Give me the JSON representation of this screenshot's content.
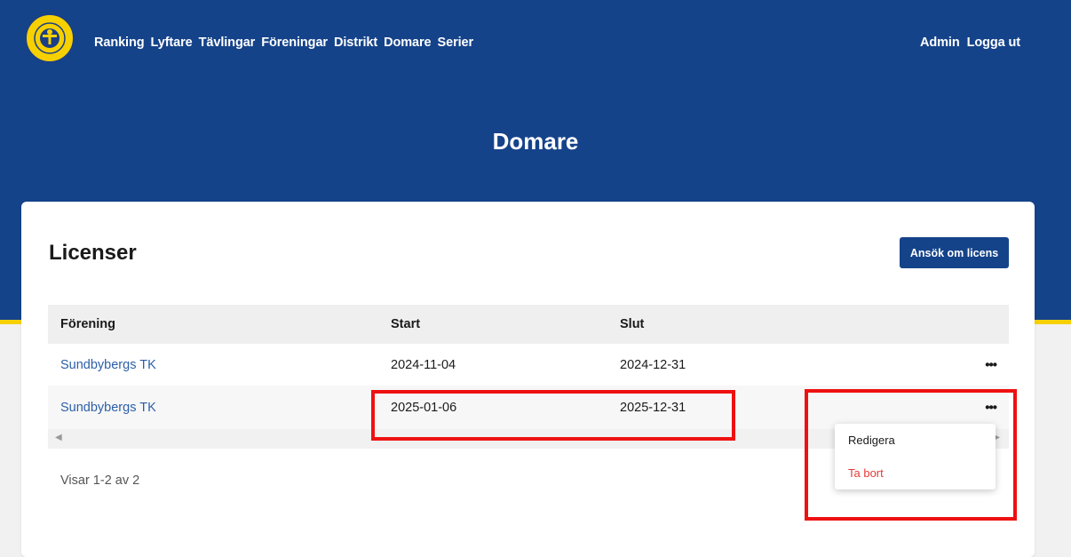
{
  "nav": {
    "items": [
      "Ranking",
      "Lyftare",
      "Tävlingar",
      "Föreningar",
      "Distrikt",
      "Domare",
      "Serier"
    ],
    "admin": "Admin",
    "logout": "Logga ut"
  },
  "page": {
    "title": "Domare"
  },
  "licenses": {
    "title": "Licenser",
    "apply_button": "Ansök om licens",
    "columns": [
      "Förening",
      "Start",
      "Slut"
    ],
    "rows": [
      {
        "club": "Sundbybergs TK",
        "start": "2024-11-04",
        "end": "2024-12-31",
        "actions": "•••"
      },
      {
        "club": "Sundbybergs TK",
        "start": "2025-01-06",
        "end": "2025-12-31",
        "actions": "•••"
      }
    ],
    "summary": "Visar 1-2 av 2",
    "scroll_left": "◀",
    "scroll_right": "▶"
  },
  "row_menu": {
    "edit": "Redigera",
    "delete": "Ta bort"
  },
  "colors": {
    "brand_blue": "#15438a",
    "accent_yellow": "#f7d000",
    "link": "#2c5fa8",
    "danger": "#e53935",
    "highlight": "#ee1111"
  },
  "icons": {
    "logo": "federation-logo-icon",
    "row_actions": "more-horizontal-icon",
    "scroll_left": "caret-left-icon",
    "scroll_right": "caret-right-icon"
  }
}
